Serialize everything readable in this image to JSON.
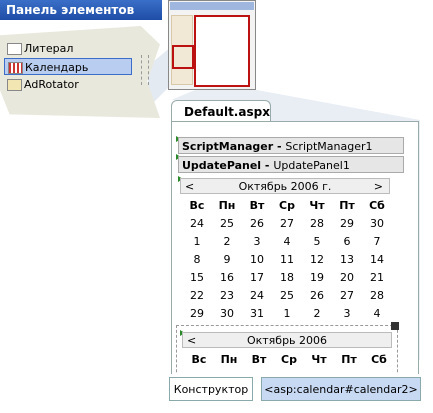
{
  "toolbox": {
    "title": "Панель элементов",
    "items": [
      {
        "label": "Литерал",
        "icon": "literal-icon"
      },
      {
        "label": "Календарь",
        "icon": "calendar-icon",
        "selected": true
      },
      {
        "label": "AdRotator",
        "icon": "adrotator-icon"
      }
    ]
  },
  "document": {
    "tab": "Default.aspx",
    "script_manager": {
      "type": "ScriptManager",
      "sep": " - ",
      "id": "ScriptManager1"
    },
    "update_panel": {
      "type": "UpdatePanel",
      "sep": " - ",
      "id": "UpdatePanel1"
    },
    "calendar1": {
      "prev": "<",
      "next": ">",
      "title": "Октябрь 2006 г.",
      "days": [
        "Вс",
        "Пн",
        "Вт",
        "Ср",
        "Чт",
        "Пт",
        "Сб"
      ],
      "weeks": [
        [
          "24",
          "25",
          "26",
          "27",
          "28",
          "29",
          "30"
        ],
        [
          "1",
          "2",
          "3",
          "4",
          "5",
          "6",
          "7"
        ],
        [
          "8",
          "9",
          "10",
          "11",
          "12",
          "13",
          "14"
        ],
        [
          "15",
          "16",
          "17",
          "18",
          "19",
          "20",
          "21"
        ],
        [
          "22",
          "23",
          "24",
          "25",
          "26",
          "27",
          "28"
        ],
        [
          "29",
          "30",
          "31",
          "1",
          "2",
          "3",
          "4"
        ]
      ]
    },
    "calendar2": {
      "prev": "<",
      "title": "Октябрь 2006",
      "days": [
        "Вс",
        "Пн",
        "Вт",
        "Ср",
        "Чт",
        "Пт",
        "Сб"
      ]
    }
  },
  "bottom": {
    "design_label": "Конструктор",
    "path_label": "<asp:calendar#calendar2>"
  },
  "colors": {
    "accent": "#1e4da6",
    "selection": "#b8cdf0",
    "highlight": "#b11111"
  }
}
